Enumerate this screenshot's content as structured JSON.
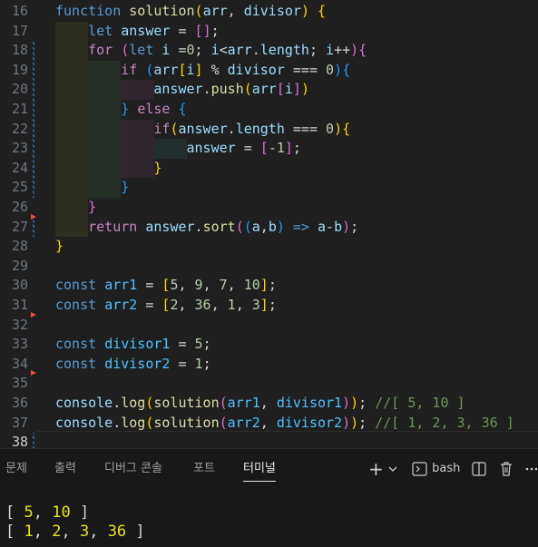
{
  "editor": {
    "lines": [
      {
        "n": "16",
        "tokens": [
          [
            "kw",
            "function"
          ],
          [
            "p",
            " "
          ],
          [
            "fn",
            "solution"
          ],
          [
            "b1",
            "("
          ],
          [
            "var",
            "arr"
          ],
          [
            "p",
            ", "
          ],
          [
            "var",
            "divisor"
          ],
          [
            "b1",
            ")"
          ],
          [
            "p",
            " "
          ],
          [
            "b1",
            "{"
          ]
        ]
      },
      {
        "n": "17",
        "tokens": [
          [
            "p",
            "    "
          ],
          [
            "kw",
            "let"
          ],
          [
            "p",
            " "
          ],
          [
            "var",
            "answer"
          ],
          [
            "p",
            " = "
          ],
          [
            "b2",
            "["
          ],
          [
            "b2",
            "]"
          ],
          [
            "p",
            ";"
          ]
        ]
      },
      {
        "n": "18",
        "tokens": [
          [
            "p",
            "    "
          ],
          [
            "ctl",
            "for"
          ],
          [
            "p",
            " "
          ],
          [
            "b2",
            "("
          ],
          [
            "kw",
            "let"
          ],
          [
            "p",
            " "
          ],
          [
            "var",
            "i"
          ],
          [
            "p",
            " ="
          ],
          [
            "num",
            "0"
          ],
          [
            "p",
            "; "
          ],
          [
            "var",
            "i"
          ],
          [
            "p",
            "<"
          ],
          [
            "var",
            "arr"
          ],
          [
            "p",
            "."
          ],
          [
            "var",
            "length"
          ],
          [
            "p",
            "; "
          ],
          [
            "var",
            "i"
          ],
          [
            "p",
            "++"
          ],
          [
            "b2",
            ")"
          ],
          [
            "b2",
            "{"
          ]
        ]
      },
      {
        "n": "19",
        "tokens": [
          [
            "p",
            "        "
          ],
          [
            "ctl",
            "if"
          ],
          [
            "p",
            " "
          ],
          [
            "b3",
            "("
          ],
          [
            "var",
            "arr"
          ],
          [
            "b1",
            "["
          ],
          [
            "var",
            "i"
          ],
          [
            "b1",
            "]"
          ],
          [
            "p",
            " % "
          ],
          [
            "var",
            "divisor"
          ],
          [
            "p",
            " === "
          ],
          [
            "num",
            "0"
          ],
          [
            "b3",
            ")"
          ],
          [
            "b3",
            "{"
          ]
        ]
      },
      {
        "n": "20",
        "tokens": [
          [
            "p",
            "            "
          ],
          [
            "var",
            "answer"
          ],
          [
            "p",
            "."
          ],
          [
            "fn",
            "push"
          ],
          [
            "b1",
            "("
          ],
          [
            "var",
            "arr"
          ],
          [
            "b2",
            "["
          ],
          [
            "var",
            "i"
          ],
          [
            "b2",
            "]"
          ],
          [
            "b1",
            ")"
          ]
        ]
      },
      {
        "n": "21",
        "tokens": [
          [
            "p",
            "        "
          ],
          [
            "b3",
            "}"
          ],
          [
            "p",
            " "
          ],
          [
            "ctl",
            "else"
          ],
          [
            "p",
            " "
          ],
          [
            "b3",
            "{"
          ]
        ]
      },
      {
        "n": "22",
        "tokens": [
          [
            "p",
            "            "
          ],
          [
            "ctl",
            "if"
          ],
          [
            "b1",
            "("
          ],
          [
            "var",
            "answer"
          ],
          [
            "p",
            "."
          ],
          [
            "var",
            "length"
          ],
          [
            "p",
            " === "
          ],
          [
            "num",
            "0"
          ],
          [
            "b1",
            ")"
          ],
          [
            "b1",
            "{"
          ]
        ]
      },
      {
        "n": "23",
        "tokens": [
          [
            "p",
            "                "
          ],
          [
            "var",
            "answer"
          ],
          [
            "p",
            " = "
          ],
          [
            "b2",
            "["
          ],
          [
            "p",
            "-"
          ],
          [
            "num",
            "1"
          ],
          [
            "b2",
            "]"
          ],
          [
            "p",
            ";"
          ]
        ]
      },
      {
        "n": "24",
        "tokens": [
          [
            "p",
            "            "
          ],
          [
            "b1",
            "}"
          ]
        ]
      },
      {
        "n": "25",
        "tokens": [
          [
            "p",
            "        "
          ],
          [
            "b3",
            "}"
          ]
        ]
      },
      {
        "n": "26",
        "tokens": [
          [
            "p",
            "    "
          ],
          [
            "b2",
            "}"
          ]
        ]
      },
      {
        "n": "27",
        "tokens": [
          [
            "p",
            "    "
          ],
          [
            "ctl",
            "return"
          ],
          [
            "p",
            " "
          ],
          [
            "var",
            "answer"
          ],
          [
            "p",
            "."
          ],
          [
            "fn",
            "sort"
          ],
          [
            "b2",
            "("
          ],
          [
            "b3",
            "("
          ],
          [
            "var",
            "a"
          ],
          [
            "p",
            ","
          ],
          [
            "var",
            "b"
          ],
          [
            "b3",
            ")"
          ],
          [
            "p",
            " "
          ],
          [
            "kw",
            "=>"
          ],
          [
            "p",
            " "
          ],
          [
            "var",
            "a"
          ],
          [
            "p",
            "-"
          ],
          [
            "var",
            "b"
          ],
          [
            "b2",
            ")"
          ],
          [
            "p",
            ";"
          ]
        ]
      },
      {
        "n": "28",
        "tokens": [
          [
            "b1",
            "}"
          ]
        ]
      },
      {
        "n": "29",
        "tokens": []
      },
      {
        "n": "30",
        "tokens": [
          [
            "kw",
            "const"
          ],
          [
            "p",
            " "
          ],
          [
            "cst",
            "arr1"
          ],
          [
            "p",
            " = "
          ],
          [
            "b1",
            "["
          ],
          [
            "num",
            "5"
          ],
          [
            "p",
            ", "
          ],
          [
            "num",
            "9"
          ],
          [
            "p",
            ", "
          ],
          [
            "num",
            "7"
          ],
          [
            "p",
            ", "
          ],
          [
            "num",
            "10"
          ],
          [
            "b1",
            "]"
          ],
          [
            "p",
            ";"
          ]
        ]
      },
      {
        "n": "31",
        "tokens": [
          [
            "kw",
            "const"
          ],
          [
            "p",
            " "
          ],
          [
            "cst",
            "arr2"
          ],
          [
            "p",
            " = "
          ],
          [
            "b1",
            "["
          ],
          [
            "num",
            "2"
          ],
          [
            "p",
            ", "
          ],
          [
            "num",
            "36"
          ],
          [
            "p",
            ", "
          ],
          [
            "num",
            "1"
          ],
          [
            "p",
            ", "
          ],
          [
            "num",
            "3"
          ],
          [
            "b1",
            "]"
          ],
          [
            "p",
            ";"
          ]
        ]
      },
      {
        "n": "32",
        "tokens": []
      },
      {
        "n": "33",
        "tokens": [
          [
            "kw",
            "const"
          ],
          [
            "p",
            " "
          ],
          [
            "cst",
            "divisor1"
          ],
          [
            "p",
            " = "
          ],
          [
            "num",
            "5"
          ],
          [
            "p",
            ";"
          ]
        ]
      },
      {
        "n": "34",
        "tokens": [
          [
            "kw",
            "const"
          ],
          [
            "p",
            " "
          ],
          [
            "cst",
            "divisor2"
          ],
          [
            "p",
            " = "
          ],
          [
            "num",
            "1"
          ],
          [
            "p",
            ";"
          ]
        ]
      },
      {
        "n": "35",
        "tokens": []
      },
      {
        "n": "36",
        "tokens": [
          [
            "var",
            "console"
          ],
          [
            "p",
            "."
          ],
          [
            "fn",
            "log"
          ],
          [
            "b1",
            "("
          ],
          [
            "fn",
            "solution"
          ],
          [
            "b2",
            "("
          ],
          [
            "cst",
            "arr1"
          ],
          [
            "p",
            ", "
          ],
          [
            "cst",
            "divisor1"
          ],
          [
            "b2",
            ")"
          ],
          [
            "b1",
            ")"
          ],
          [
            "p",
            "; "
          ],
          [
            "cm",
            "//[ 5, 10 ]"
          ]
        ]
      },
      {
        "n": "37",
        "tokens": [
          [
            "var",
            "console"
          ],
          [
            "p",
            "."
          ],
          [
            "fn",
            "log"
          ],
          [
            "b1",
            "("
          ],
          [
            "fn",
            "solution"
          ],
          [
            "b2",
            "("
          ],
          [
            "cst",
            "arr2"
          ],
          [
            "p",
            ", "
          ],
          [
            "cst",
            "divisor2"
          ],
          [
            "b2",
            ")"
          ],
          [
            "b1",
            ")"
          ],
          [
            "p",
            "; "
          ],
          [
            "cm",
            "//[ 1, 2, 3, 36 ]"
          ]
        ]
      },
      {
        "n": "38",
        "tokens": []
      }
    ]
  },
  "panel": {
    "tabs": [
      {
        "label": "문제",
        "active": false
      },
      {
        "label": "출력",
        "active": false
      },
      {
        "label": "디버그 콘솔",
        "active": false
      },
      {
        "label": "포트",
        "active": false
      },
      {
        "label": "터미널",
        "active": true
      }
    ],
    "shell_label": "bash",
    "add_icon": "plus-icon",
    "terminal_lines": [
      [
        [
          "p",
          "[ "
        ],
        [
          "tnum",
          "5"
        ],
        [
          "p",
          ", "
        ],
        [
          "tnum",
          "10"
        ],
        [
          "p",
          " ]"
        ]
      ],
      [
        [
          "p",
          "[ "
        ],
        [
          "tnum",
          "1"
        ],
        [
          "p",
          ", "
        ],
        [
          "tnum",
          "2"
        ],
        [
          "p",
          ", "
        ],
        [
          "tnum",
          "3"
        ],
        [
          "p",
          ", "
        ],
        [
          "tnum",
          "36"
        ],
        [
          "p",
          " ]"
        ]
      ]
    ]
  }
}
